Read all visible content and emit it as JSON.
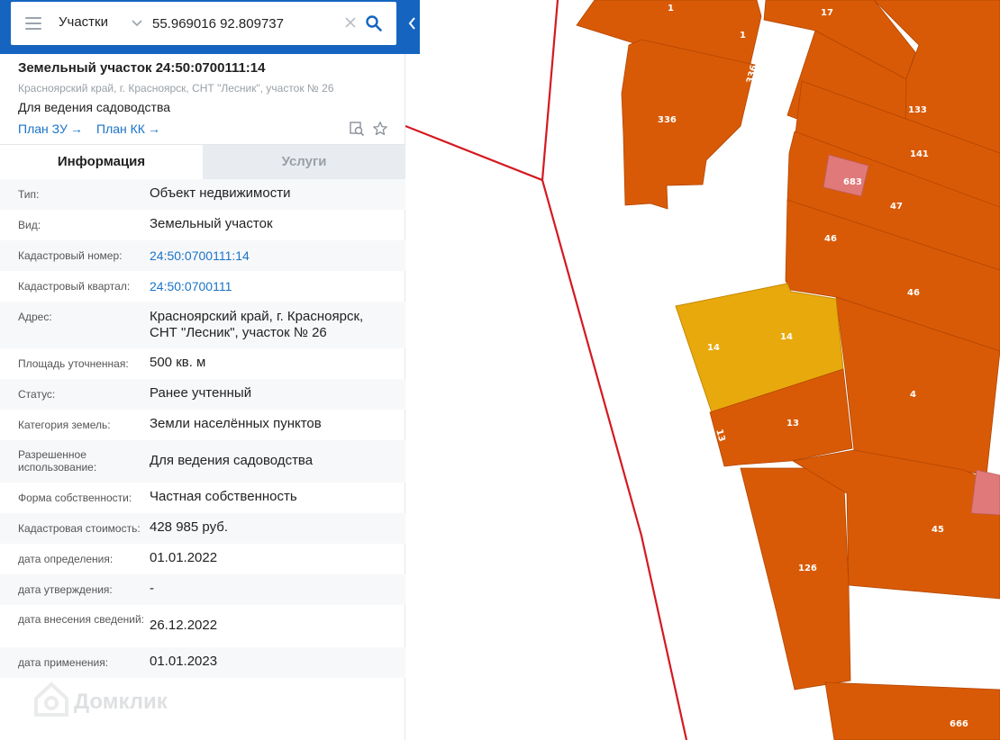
{
  "search": {
    "layer_label": "Участки",
    "query": "55.969016 92.809737"
  },
  "plot": {
    "title": "Земельный участок 24:50:0700111:14",
    "address": "Красноярский край, г. Красноярск, СНТ \"Лесник\", участок № 26",
    "use": "Для ведения садоводства",
    "plan_zu": "План ЗУ",
    "plan_kk": "План КК"
  },
  "tabs": {
    "info": "Информация",
    "services": "Услуги"
  },
  "rows": [
    {
      "label": "Тип:",
      "value": "Объект недвижимости"
    },
    {
      "label": "Вид:",
      "value": "Земельный участок"
    },
    {
      "label": "Кадастровый номер:",
      "value": "24:50:0700111:14"
    },
    {
      "label": "Кадастровый квартал:",
      "value": "24:50:0700111"
    },
    {
      "label": "Адрес:",
      "value": "Красноярский край, г. Красноярск, СНТ \"Лесник\", участок № 26"
    },
    {
      "label": "Площадь уточненная:",
      "value": "500 кв. м"
    },
    {
      "label": "Статус:",
      "value": "Ранее учтенный"
    },
    {
      "label": "Категория земель:",
      "value": "Земли населённых пунктов"
    },
    {
      "label": "Разрешенное использование:",
      "value": "Для ведения садоводства"
    },
    {
      "label": "Форма собственности:",
      "value": "Частная собственность"
    },
    {
      "label": "Кадастровая стоимость:",
      "value": "428 985 руб."
    },
    {
      "label": "дата определения:",
      "value": "01.01.2022"
    },
    {
      "label": "дата утверждения:",
      "value": "-"
    },
    {
      "label": "дата внесения сведений:",
      "value": "26.12.2022"
    },
    {
      "label": "дата применения:",
      "value": "01.01.2023"
    }
  ],
  "map": {
    "plot_fill": "#d95a06",
    "selected_fill": "#e8a90c",
    "building_fill": "#e07a7a",
    "boundary_color": "#d41920",
    "labels": {
      "l1a": "1",
      "l1b": "1",
      "l17": "17",
      "l336a": "336",
      "l336b": "336",
      "l133": "133",
      "l141": "141",
      "l683": "683",
      "l47": "47",
      "l46a": "46",
      "l46b": "46",
      "l14a": "14",
      "l14b": "14",
      "l4": "4",
      "l13a": "13",
      "l13b": "13",
      "l45": "45",
      "l126": "126",
      "l666": "666"
    }
  },
  "watermark": {
    "brand": "Домклик",
    "logo_icon": "domclick-logo-icon"
  },
  "colors": {
    "brand_blue": "#1565c0",
    "link_blue": "#1a73c8"
  }
}
